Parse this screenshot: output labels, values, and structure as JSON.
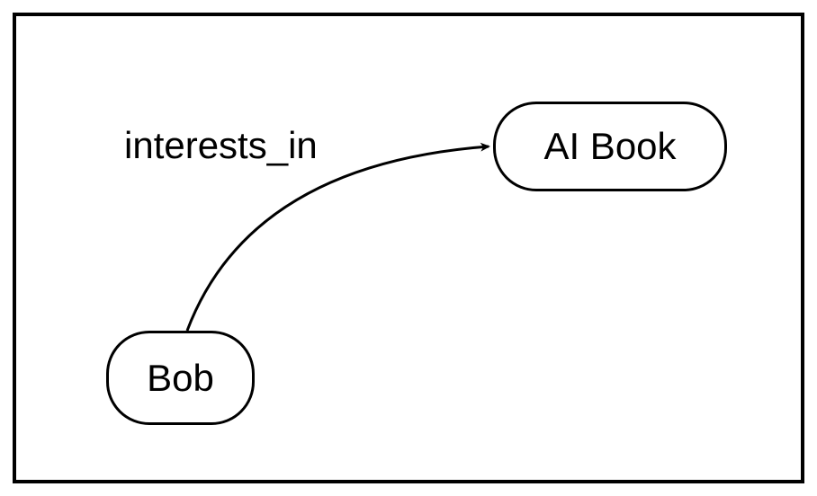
{
  "diagram": {
    "nodes": {
      "source": {
        "label": "Bob"
      },
      "target": {
        "label": "AI Book"
      }
    },
    "edge": {
      "label": "interests_in"
    }
  }
}
